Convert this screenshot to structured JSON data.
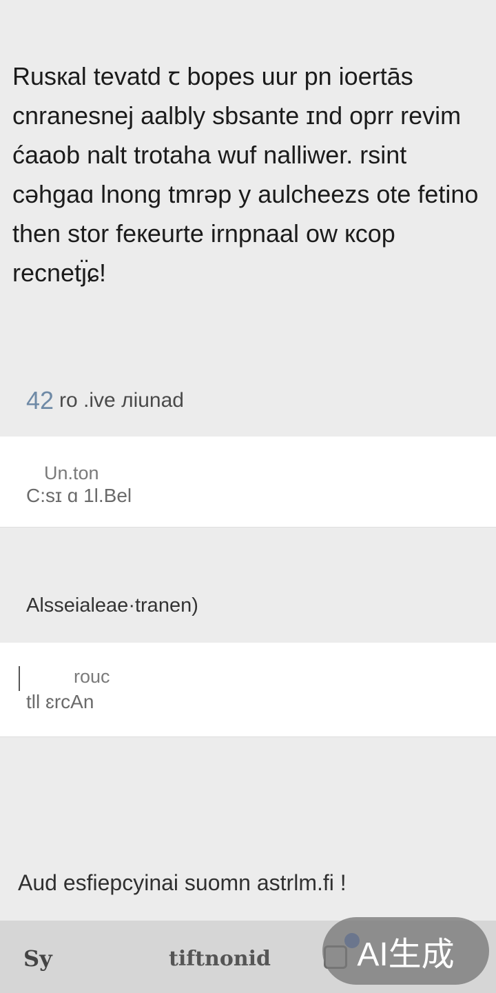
{
  "intro_text": "Rusкal tevatd ꞇ bopes uur pn ioertās cnranesnej aalbly sbsante ɪnd oprr revim ćaaob nalt trotaha wuf nalliwer. rsint cəhgaɑ lnong tmrəp y aulcheezs ote fetino then stor feкeurte irnpnaal ow кcop recnetȷ̈ɕ!",
  "section1": {
    "number": "42",
    "label": "ro .ive лiunad"
  },
  "card1": {
    "line1": "Un.ton",
    "line2": "C:sɪ ɑ 1l.Bel"
  },
  "section2": {
    "label": "Alsseialeae·tranen)"
  },
  "card2": {
    "line1": "rouc",
    "line2": "tll ɛrcAn"
  },
  "footer_text": "Aud esfiepcyinai suomn astrlm.fi !",
  "bottom_bar": {
    "left_label": "Sy",
    "middle_label": "tiftnonid",
    "right_icon": "square-icon"
  },
  "watermark": "AI生成",
  "colors": {
    "background": "#ececec",
    "card": "#ffffff",
    "bottom_bar": "#d6d6d6",
    "accent_blue": "#3b6fd6"
  }
}
